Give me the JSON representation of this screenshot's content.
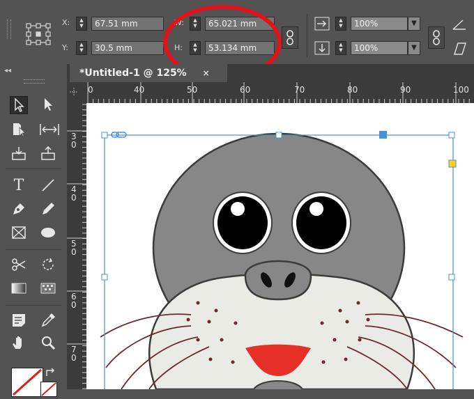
{
  "control_panel": {
    "x_label": "X:",
    "y_label": "Y:",
    "w_label": "W:",
    "h_label": "H:",
    "x_value": "67.51 mm",
    "y_value": "30.5 mm",
    "w_value": "65.021 mm",
    "h_value": "53.134 mm",
    "scale_x": "100%",
    "scale_y": "100%"
  },
  "document_tab": {
    "title": "*Untitled-1 @ 125%",
    "close_glyph": "×"
  },
  "rulers": {
    "horizontal_ticks": [
      "0",
      "40",
      "50",
      "60",
      "70",
      "80",
      "90",
      "100"
    ],
    "vertical_ticks": [
      "3\n0",
      "4\n0",
      "5\n0",
      "6\n0",
      "7\n0"
    ]
  },
  "colors": {
    "panel": "#535353",
    "selection": "#4a90d9",
    "highlight_circle": "#e0141a",
    "seal_head": "#878787",
    "seal_muzzle": "#ebebe6",
    "tongue": "#e63027"
  }
}
